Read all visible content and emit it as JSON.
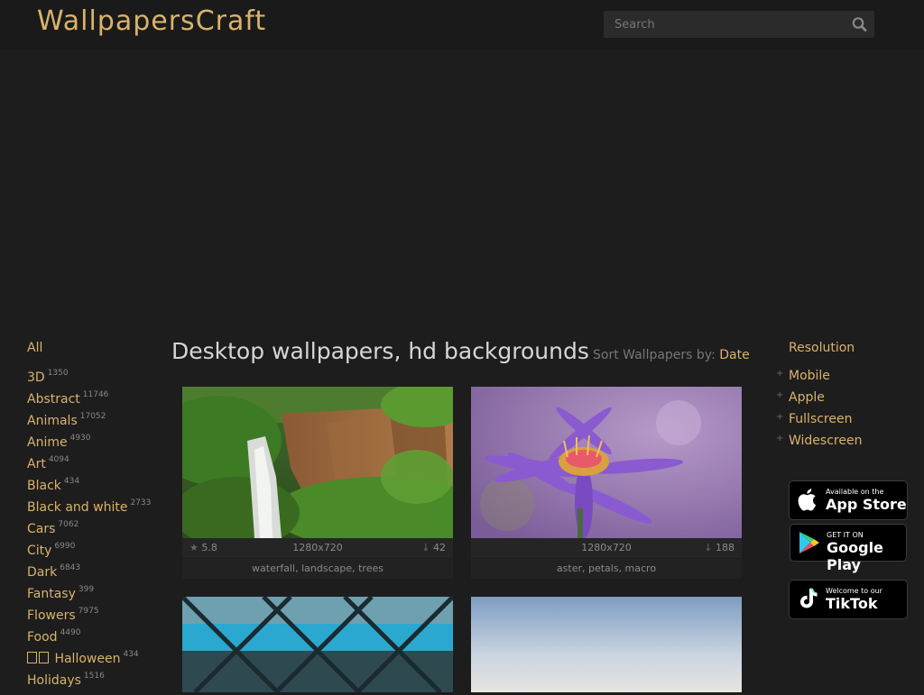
{
  "header": {
    "logo": "WallpapersCraft",
    "search_placeholder": "Search"
  },
  "sidebar": {
    "all_label": "All",
    "categories": [
      {
        "label": "3D",
        "count": "1350"
      },
      {
        "label": "Abstract",
        "count": "11746"
      },
      {
        "label": "Animals",
        "count": "17052"
      },
      {
        "label": "Anime",
        "count": "4930"
      },
      {
        "label": "Art",
        "count": "4094"
      },
      {
        "label": "Black",
        "count": "434"
      },
      {
        "label": "Black and white",
        "count": "2733"
      },
      {
        "label": "Cars",
        "count": "7062"
      },
      {
        "label": "City",
        "count": "6990"
      },
      {
        "label": "Dark",
        "count": "6843"
      },
      {
        "label": "Fantasy",
        "count": "399"
      },
      {
        "label": "Flowers",
        "count": "7975"
      },
      {
        "label": "Food",
        "count": "4490"
      },
      {
        "label": "Halloween",
        "count": "434"
      },
      {
        "label": "Holidays",
        "count": "1516"
      }
    ]
  },
  "main": {
    "title": "Desktop wallpapers, hd backgrounds",
    "sort_label": "Sort Wallpapers by:",
    "sort_value": "Date",
    "cards": [
      {
        "rating": "5.8",
        "resolution": "1280x720",
        "downloads": "42",
        "tags": "waterfall, landscape, trees"
      },
      {
        "rating": "",
        "resolution": "1280x720",
        "downloads": "188",
        "tags": "aster, petals, macro"
      }
    ]
  },
  "right": {
    "title": "Resolution",
    "items": [
      "Mobile",
      "Apple",
      "Fullscreen",
      "Widescreen"
    ],
    "badges": {
      "appstore_small": "Available on the",
      "appstore_big": "App Store",
      "google_small": "GET IT ON",
      "google_big": "Google Play",
      "tiktok_small": "Welcome to our",
      "tiktok_big": "TikTok"
    }
  },
  "colors": {
    "accent": "#d9b36b",
    "background": "#1d1d1d",
    "header": "#1a1a1a"
  }
}
